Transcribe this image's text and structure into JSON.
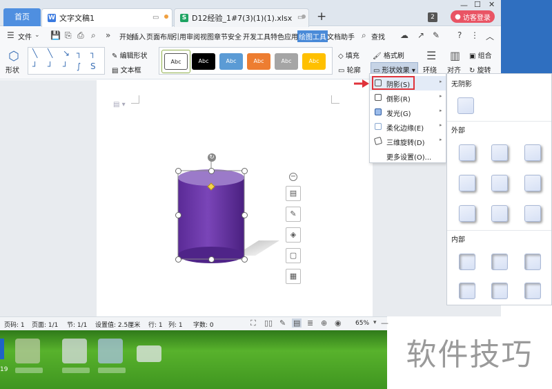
{
  "tabs": {
    "home": "首页",
    "doc": "文字文稿1",
    "sheet": "D12经验_1#7(3)(1)(1).xlsx",
    "count": "2",
    "login": "访客登录"
  },
  "menu": [
    "文件",
    "开始",
    "插入",
    "页面布局",
    "引用",
    "审阅",
    "视图",
    "章节",
    "安全",
    "开发工具",
    "特色应用",
    "绘图工具",
    "文档助手",
    "查找"
  ],
  "ribbon": {
    "shape": "形状",
    "edit_shape": "编辑形状",
    "text_box": "文本框",
    "style_sample": "Abc",
    "fill": "填充",
    "format_brush": "格式刷",
    "outline": "轮廓",
    "shape_effect": "形状效果",
    "wrap": "环绕",
    "align": "对齐",
    "group": "组合",
    "rotate": "旋转"
  },
  "effects_menu": {
    "items": [
      "阴影(S)",
      "倒影(R)",
      "发光(G)",
      "柔化边缘(E)",
      "三维旋转(D)",
      "更多设置(O)..."
    ]
  },
  "shadow_menu": {
    "no_shadow": "无阴影",
    "outer": "外部",
    "inner": "内部"
  },
  "status": {
    "page_num": "页码: 1",
    "pages": "页面: 1/1",
    "section": "节: 1/1",
    "setting": "设置值: 2.5厘米",
    "row": "行: 1",
    "col": "列: 1",
    "words": "字数: 0",
    "zoom": "65%"
  },
  "watermark": "软件技巧",
  "clock": "19",
  "colors": {
    "accent": "#4a8ad8",
    "login": "#e95464",
    "highlight_red": "#e0323a",
    "cylinder": "#6a35a8"
  },
  "style_swatches": [
    "#ffffff",
    "#000000",
    "#5b9bd5",
    "#ed7d31",
    "#a5a5a5",
    "#ffc000"
  ]
}
